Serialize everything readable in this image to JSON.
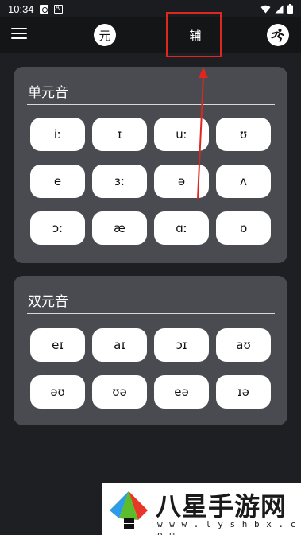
{
  "status_bar": {
    "time": "10:34"
  },
  "header": {
    "mode_left": "元",
    "mode_right": "辅"
  },
  "monophthongs": {
    "title": "单元音",
    "keys": [
      "iː",
      "ɪ",
      "uː",
      "ʊ",
      "e",
      "ɜː",
      "ə",
      "ʌ",
      "ɔː",
      "æ",
      "ɑː",
      "ɒ"
    ]
  },
  "diphthongs": {
    "title": "双元音",
    "keys": [
      "eɪ",
      "aɪ",
      "ɔɪ",
      "aʊ",
      "əʊ",
      "ʊə",
      "eə",
      "ɪə"
    ]
  },
  "watermark": {
    "brand": "八星手游网",
    "url": "w w w . l y s h b x . c o m"
  },
  "colors": {
    "background": "#1e1f23",
    "card": "#4a4b50",
    "key": "#ffffff",
    "annotation": "#e0271f"
  }
}
